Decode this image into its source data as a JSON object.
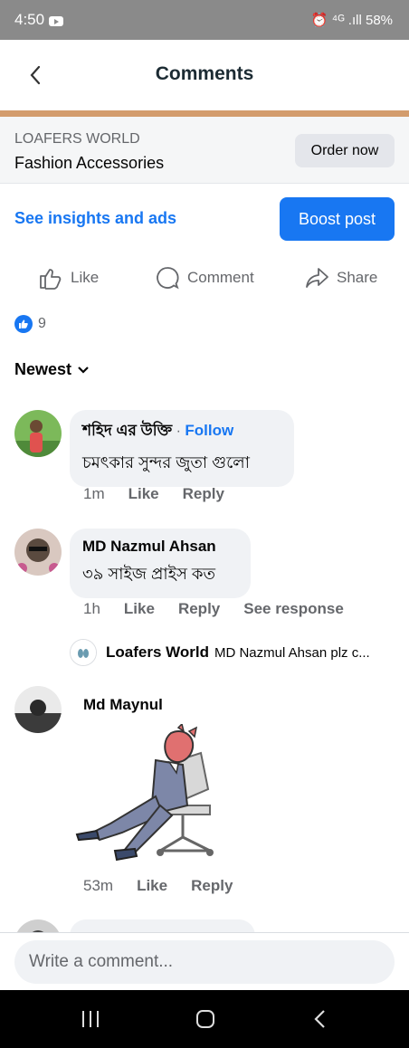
{
  "status_bar": {
    "time": "4:50",
    "right": "⏰ ⁴ᴳ .ıll 58%"
  },
  "header": {
    "title": "Comments"
  },
  "shop": {
    "category": "LOAFERS WORLD",
    "name": "Fashion Accessories",
    "order_label": "Order now"
  },
  "insights_label": "See insights and ads",
  "boost_label": "Boost post",
  "actions": {
    "like": "Like",
    "comment": "Comment",
    "share": "Share"
  },
  "reactions": {
    "count": "9"
  },
  "sort": {
    "label": "Newest"
  },
  "comments": [
    {
      "author": "শহিদ এর উক্তি",
      "follow": "Follow",
      "text": "চমৎকার সুন্দর জুতা গুলো",
      "time": "1m",
      "like": "Like",
      "reply": "Reply"
    },
    {
      "author": "MD Nazmul Ahsan",
      "text": "৩৯ সাইজ প্রাইস কত",
      "time": "1h",
      "like": "Like",
      "reply": "Reply",
      "see_response": "See response",
      "reply_preview": {
        "author": "Loafers World",
        "text": "MD Nazmul Ahsan plz c..."
      }
    },
    {
      "author": "Md Maynul",
      "time": "53m",
      "like": "Like",
      "reply": "Reply"
    }
  ],
  "composer": {
    "placeholder": "Write a comment..."
  },
  "colors": {
    "accent": "#1877f2",
    "tan": "#d39c6d"
  }
}
